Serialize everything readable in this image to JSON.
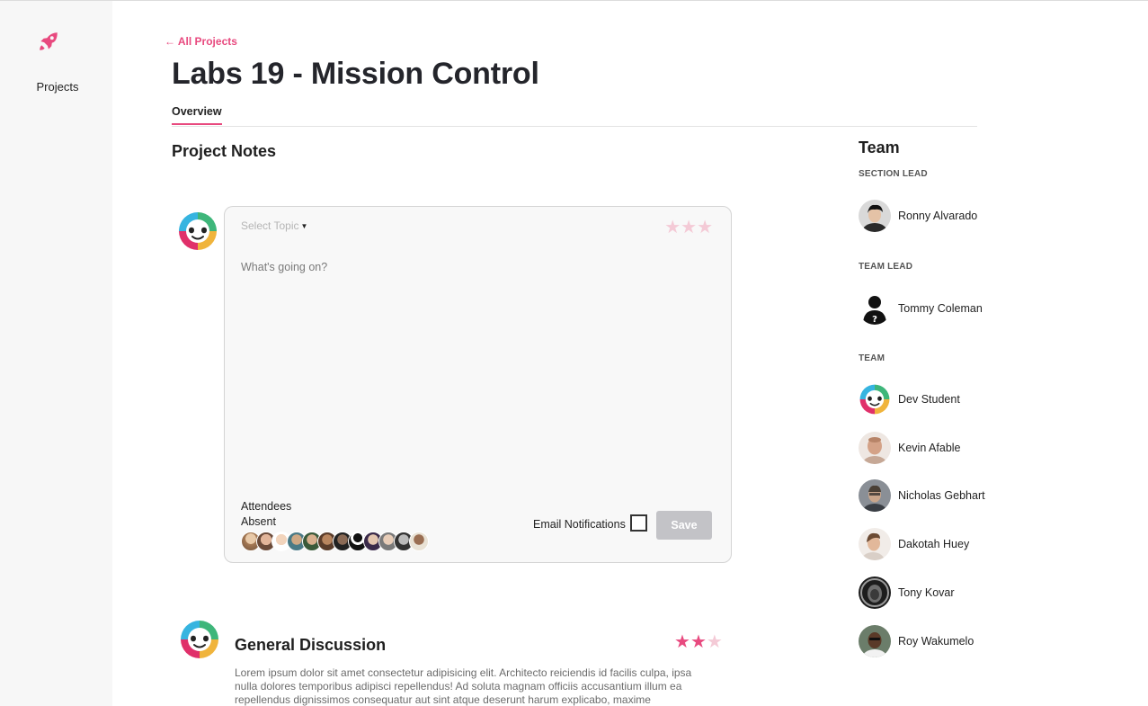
{
  "sidebar": {
    "icon": "rocket-icon",
    "nav_label": "Projects"
  },
  "header": {
    "back_link": "← All Projects",
    "title": "Labs 19 - Mission Control",
    "tabs": [
      {
        "label": "Overview",
        "active": true
      }
    ]
  },
  "notes": {
    "section_title": "Project Notes",
    "editor": {
      "topic_placeholder": "Select Topic",
      "note_placeholder": "What's going on?",
      "rating": 0,
      "rating_max": 3,
      "attendees_label": "Attendees",
      "absent_label": "Absent",
      "email_notifications_label": "Email Notifications",
      "email_notifications_checked": false,
      "save_label": "Save"
    },
    "posts": [
      {
        "title": "General Discussion",
        "rating": 2,
        "rating_max": 3,
        "body_lines": [
          "Lorem ipsum dolor sit amet consectetur adipisicing elit. Architecto reiciendis id facilis culpa, ipsa",
          "nulla dolores temporibus adipisci repellendus! Ad soluta magnam officiis accusantium illum ea",
          "repellendus dignissimos consequatur aut sint atque deserunt harum explicabo, maxime"
        ]
      }
    ]
  },
  "team": {
    "title": "Team",
    "section_lead_label": "SECTION LEAD",
    "section_lead": "Ronny Alvarado",
    "team_lead_label": "TEAM LEAD",
    "team_lead": "Tommy Coleman",
    "team_label": "TEAM",
    "members": [
      "Dev Student",
      "Kevin Afable",
      "Nicholas Gebhart",
      "Dakotah Huey",
      "Tony Kovar",
      "Roy Wakumelo"
    ]
  },
  "colors": {
    "accent": "#e84a7f",
    "star_off": "#f4cad6",
    "save_disabled": "#c3c3c7"
  }
}
